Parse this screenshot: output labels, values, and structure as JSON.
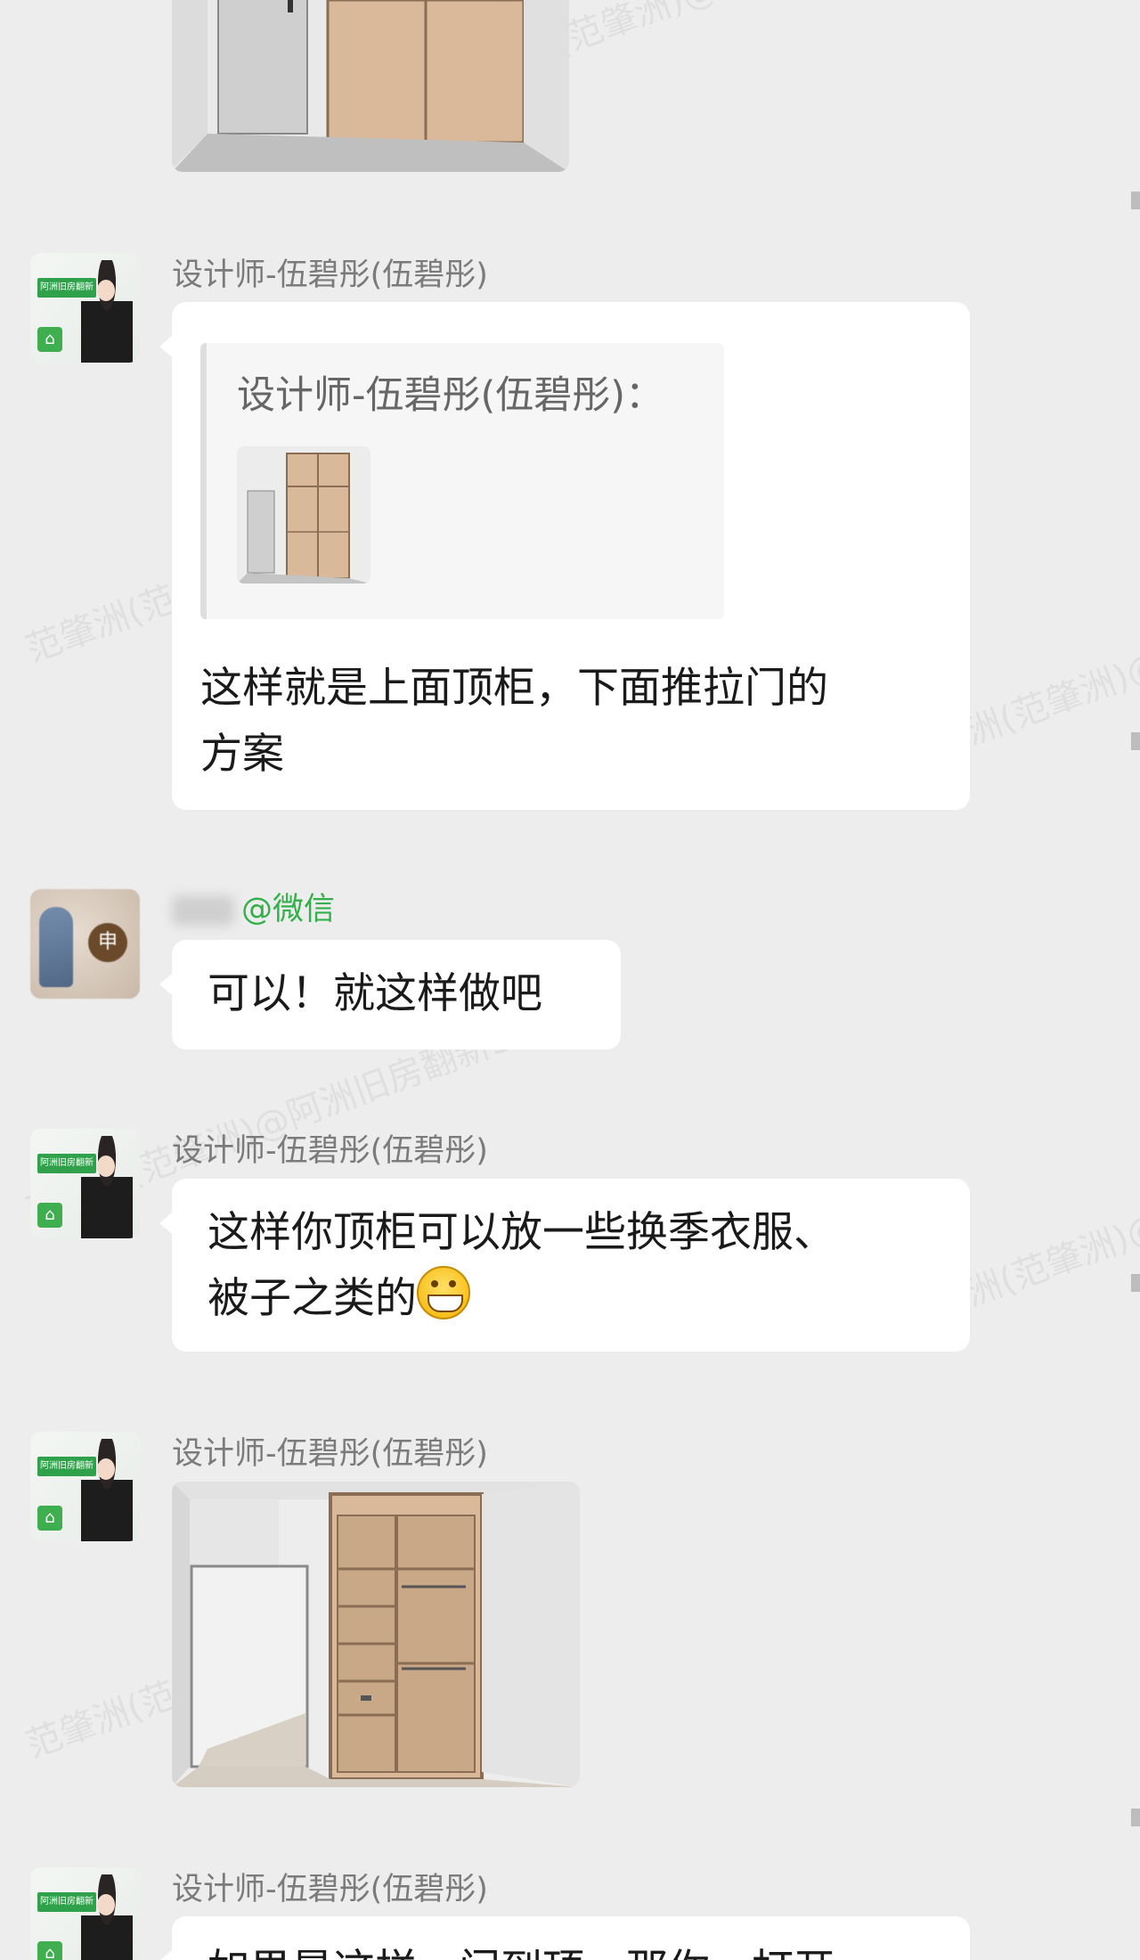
{
  "watermark": "范肇洲(范肇洲)@阿洲旧房翻新3040",
  "messages": {
    "m1": {
      "sender": "设计师-伍碧彤(伍碧彤)",
      "quote_author": "设计师-伍碧彤(伍碧彤)：",
      "text_line1": "这样就是上面顶柜，下面推拉门的",
      "text_line2": "方案"
    },
    "m2": {
      "sender_tag": "@微信",
      "text": "可以！就这样做吧",
      "avatar_badge": "申"
    },
    "m3": {
      "sender": "设计师-伍碧彤(伍碧彤)",
      "text_line1": "这样你顶柜可以放一些换季衣服、",
      "text_line2": "被子之类的",
      "emoji": "grinning-face"
    },
    "m4": {
      "sender": "设计师-伍碧彤(伍碧彤)"
    },
    "m5": {
      "sender": "设计师-伍碧彤(伍碧彤)",
      "text": "如果是这样，门到顶，那你一打开"
    }
  },
  "avatar_banner": "阿洲旧房翻新",
  "colors": {
    "background": "#ededed",
    "bubble": "#ffffff",
    "sender_name": "#7b7b7b",
    "wechat_tag": "#33b04a"
  }
}
